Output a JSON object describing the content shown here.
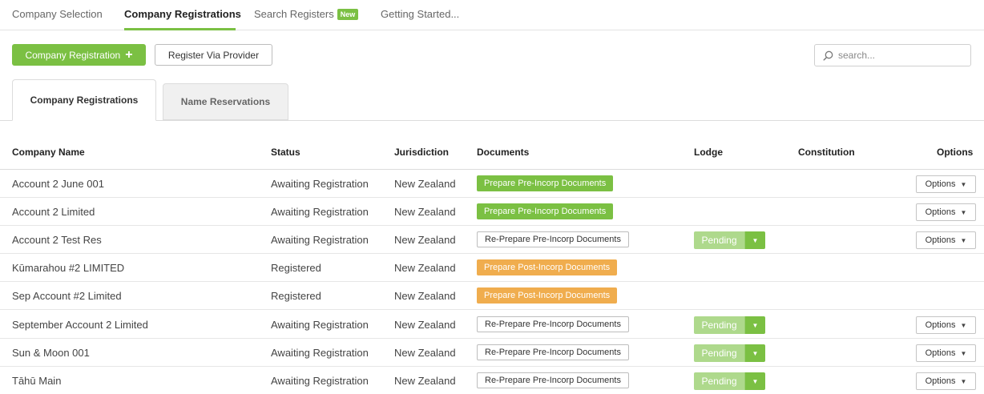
{
  "nav": {
    "items": [
      "Company Selection",
      "Company Registrations",
      "Search Registers",
      "Getting Started..."
    ],
    "badge": "New",
    "accent": "#7bc043"
  },
  "toolbar": {
    "add_label": "Company Registration",
    "add_icon": "+",
    "provider_label": "Register Via Provider"
  },
  "search": {
    "placeholder": "search..."
  },
  "tabs": [
    "Company Registrations",
    "Name Reservations"
  ],
  "table": {
    "headers": [
      "Company Name",
      "Status",
      "Jurisdiction",
      "Documents",
      "Lodge",
      "Constitution",
      "Options"
    ],
    "rows": [
      {
        "name": "Account 2 June 001",
        "status": "Awaiting Registration",
        "jurisdiction": "New Zealand",
        "doc": "Prepare Pre-Incorp Documents",
        "doc_style": "green",
        "lodge": "",
        "options": "Options"
      },
      {
        "name": "Account 2 Limited",
        "status": "Awaiting Registration",
        "jurisdiction": "New Zealand",
        "doc": "Prepare Pre-Incorp Documents",
        "doc_style": "green",
        "lodge": "",
        "options": "Options"
      },
      {
        "name": "Account 2 Test Res",
        "status": "Awaiting Registration",
        "jurisdiction": "New Zealand",
        "doc": "Re-Prepare Pre-Incorp Documents",
        "doc_style": "outline",
        "lodge": "Pending",
        "options": "Options"
      },
      {
        "name": "Kūmarahou #2 LIMITED",
        "status": "Registered",
        "jurisdiction": "New Zealand",
        "doc": "Prepare Post-Incorp Documents",
        "doc_style": "orange",
        "lodge": "",
        "options": ""
      },
      {
        "name": "Sep Account #2 Limited",
        "status": "Registered",
        "jurisdiction": "New Zealand",
        "doc": "Prepare Post-Incorp Documents",
        "doc_style": "orange",
        "lodge": "",
        "options": ""
      },
      {
        "name": "September Account 2 Limited",
        "status": "Awaiting Registration",
        "jurisdiction": "New Zealand",
        "doc": "Re-Prepare Pre-Incorp Documents",
        "doc_style": "outline",
        "lodge": "Pending",
        "options": "Options"
      },
      {
        "name": "Sun & Moon 001",
        "status": "Awaiting Registration",
        "jurisdiction": "New Zealand",
        "doc": "Re-Prepare Pre-Incorp Documents",
        "doc_style": "outline",
        "lodge": "Pending",
        "options": "Options"
      },
      {
        "name": "Tāhū Main",
        "status": "Awaiting Registration",
        "jurisdiction": "New Zealand",
        "doc": "Re-Prepare Pre-Incorp Documents",
        "doc_style": "outline",
        "lodge": "Pending",
        "options": "Options"
      }
    ]
  }
}
